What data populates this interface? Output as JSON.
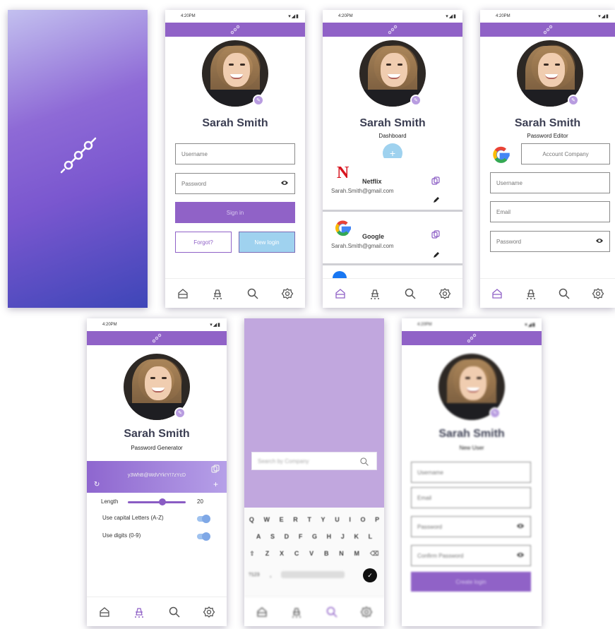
{
  "time": "4:20PM",
  "profile": {
    "name": "Sarah Smith"
  },
  "login": {
    "username_placeholder": "Username",
    "password_placeholder": "Password",
    "signin_label": "Sign in",
    "forgot_label": "Forgot?",
    "newlogin_label": "New login"
  },
  "dashboard": {
    "subtitle": "Dashboard",
    "entries": [
      {
        "title": "Netflix",
        "email": "Sarah.Smith@gmail.com"
      },
      {
        "title": "Google",
        "email": "Sarah.Smith@gmail.com"
      }
    ]
  },
  "editor": {
    "subtitle": "Password Editor",
    "account_placeholder": "Account Company",
    "username_placeholder": "Username",
    "email_placeholder": "Email",
    "password_placeholder": "Password"
  },
  "generator": {
    "subtitle": "Password Generator",
    "generated": "y3WhB@WdVYk!Y!7zYcD",
    "length_label": "Length",
    "length_value": "20",
    "length_fraction": 0.6,
    "capital_label": "Use capital Letters (A-Z)",
    "digits_label": "Use digits (0-9)"
  },
  "search": {
    "placeholder": "Search by Company",
    "kb_row1": [
      "Q",
      "W",
      "E",
      "R",
      "T",
      "Y",
      "U",
      "I",
      "O",
      "P"
    ],
    "kb_row2": [
      "A",
      "S",
      "D",
      "F",
      "G",
      "H",
      "J",
      "K",
      "L"
    ],
    "kb_row3": [
      "⇧",
      "Z",
      "X",
      "C",
      "V",
      "B",
      "N",
      "M",
      "⌫"
    ],
    "kb_num": "?123",
    "kb_comma": ","
  },
  "newuser": {
    "subtitle": "New User",
    "username_placeholder": "Username",
    "email_placeholder": "Email",
    "password_placeholder": "Password",
    "confirm_placeholder": "Confirm Password",
    "create_label": "Create login"
  },
  "colors": {
    "primary": "#9062c7",
    "accent_blue": "#9fd2ef",
    "outline_purple": "#9062c7"
  }
}
